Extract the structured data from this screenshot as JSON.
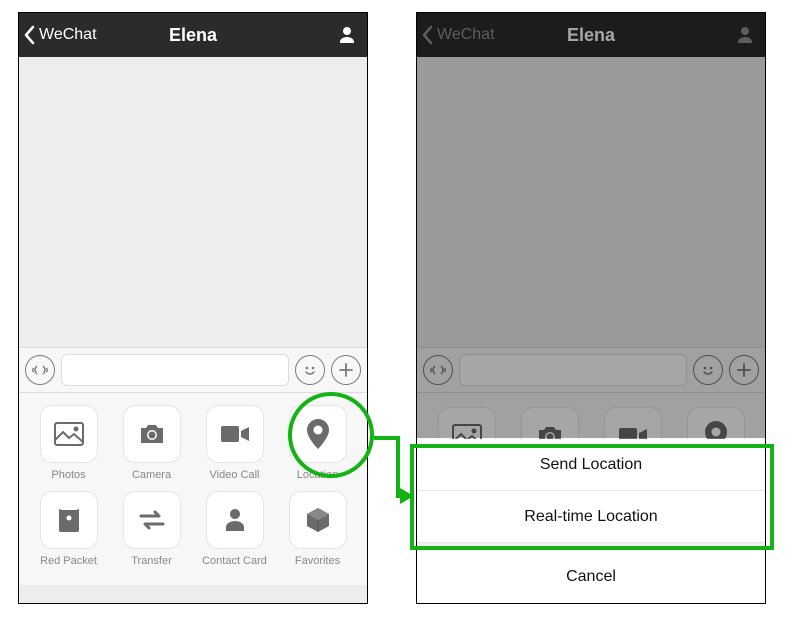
{
  "header": {
    "back_label": "WeChat",
    "title": "Elena"
  },
  "attach": {
    "row1": [
      {
        "label": "Photos"
      },
      {
        "label": "Camera"
      },
      {
        "label": "Video Call"
      },
      {
        "label": "Location"
      }
    ],
    "row2": [
      {
        "label": "Red Packet"
      },
      {
        "label": "Transfer"
      },
      {
        "label": "Contact Card"
      },
      {
        "label": "Favorites"
      }
    ]
  },
  "sheet": {
    "item1": "Send Location",
    "item2": "Real-time Location",
    "cancel": "Cancel"
  },
  "annotation": {
    "highlight_color": "#12b312"
  }
}
